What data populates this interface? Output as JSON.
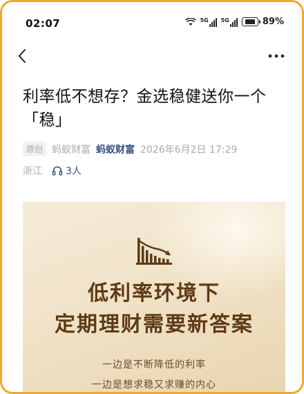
{
  "status_bar": {
    "time": "02:07",
    "network_1": "5G",
    "network_2": "5G",
    "battery": "89%",
    "icons": [
      "wifi-icon",
      "signal-icon",
      "signal-icon",
      "battery-icon"
    ]
  },
  "nav": {
    "back_icon": "back-chevron-icon",
    "more_icon": "more-dots-icon"
  },
  "article": {
    "title": "利率低不想存？金选稳健送你一个「稳」",
    "tag": "原创",
    "author": "蚂蚁财富",
    "source": "蚂蚁财富",
    "datetime": "2026年6月2日 17:29",
    "location": "浙江",
    "listeners": "3人",
    "headphone_icon": "headphone-icon"
  },
  "banner": {
    "headline_1": "低利率环境下",
    "headline_2": "定期理财需要新答案",
    "sub_1": "一边是不断降低的利率",
    "sub_2": "一边是想求稳又求赚的内心",
    "icon": "declining-chart-icon"
  },
  "colors": {
    "frame_border": "#f0a830",
    "link": "#3a4f80",
    "banner_text": "#5e3a16",
    "banner_bg": "#f1e4c9"
  }
}
